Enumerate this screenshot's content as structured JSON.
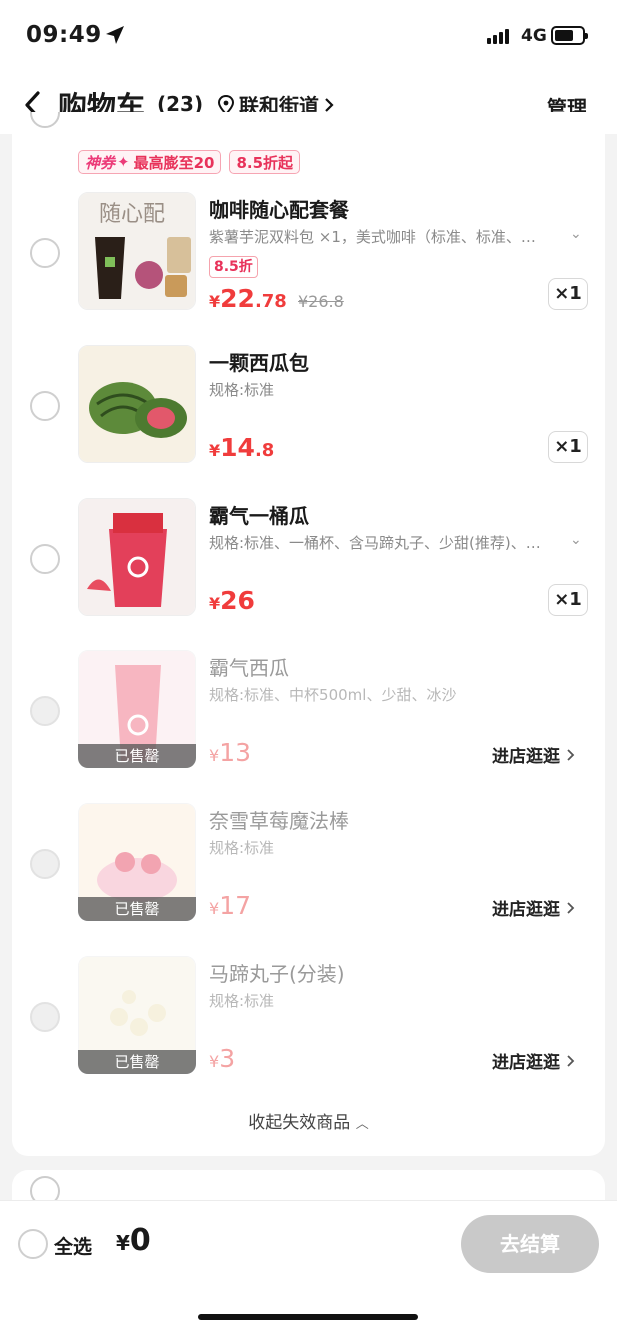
{
  "status_bar": {
    "time": "09:49",
    "network": "4G"
  },
  "header": {
    "title": "购物车",
    "count": "(23)",
    "location": "联和街道",
    "manage": "管理"
  },
  "promo": {
    "shen": "神券",
    "coupon_text": "最高膨至20",
    "discount_text": "8.5折起"
  },
  "items": [
    {
      "name": "咖啡随心配套餐",
      "spec": "紫薯芋泥双料包 ×1，美式咖啡（标准、标准、…",
      "discount": "8.5折",
      "currency": "¥",
      "price_int": "22",
      "price_dec": ".78",
      "orig_price": "¥26.8",
      "qty": "×1",
      "sold_out": false
    },
    {
      "name": "一颗西瓜包",
      "spec": "规格:标准",
      "currency": "¥",
      "price_int": "14",
      "price_dec": ".8",
      "qty": "×1",
      "sold_out": false
    },
    {
      "name": "霸气一桶瓜",
      "spec": "规格:标准、一桶杯、含马蹄丸子、少甜(推荐)、…",
      "currency": "¥",
      "price_int": "26",
      "price_dec": "",
      "qty": "×1",
      "sold_out": false
    },
    {
      "name": "霸气西瓜",
      "spec": "规格:标准、中杯500ml、少甜、冰沙",
      "currency": "¥",
      "price_int": "13",
      "sold_label": "已售罄",
      "go_store": "进店逛逛",
      "sold_out": true
    },
    {
      "name": "奈雪草莓魔法棒",
      "spec": "规格:标准",
      "currency": "¥",
      "price_int": "17",
      "sold_label": "已售罄",
      "go_store": "进店逛逛",
      "sold_out": true
    },
    {
      "name": "马蹄丸子(分装)",
      "spec": "规格:标准",
      "currency": "¥",
      "price_int": "3",
      "sold_label": "已售罄",
      "go_store": "进店逛逛",
      "sold_out": true
    }
  ],
  "collapse_label": "收起失效商品",
  "bottom": {
    "select_all": "全选",
    "currency": "¥",
    "total": "0",
    "checkout": "去结算"
  },
  "colors": {
    "price_red": "#f03c3c",
    "promo_pink": "#e8325a",
    "checkout_disabled": "#c9c9c9"
  }
}
